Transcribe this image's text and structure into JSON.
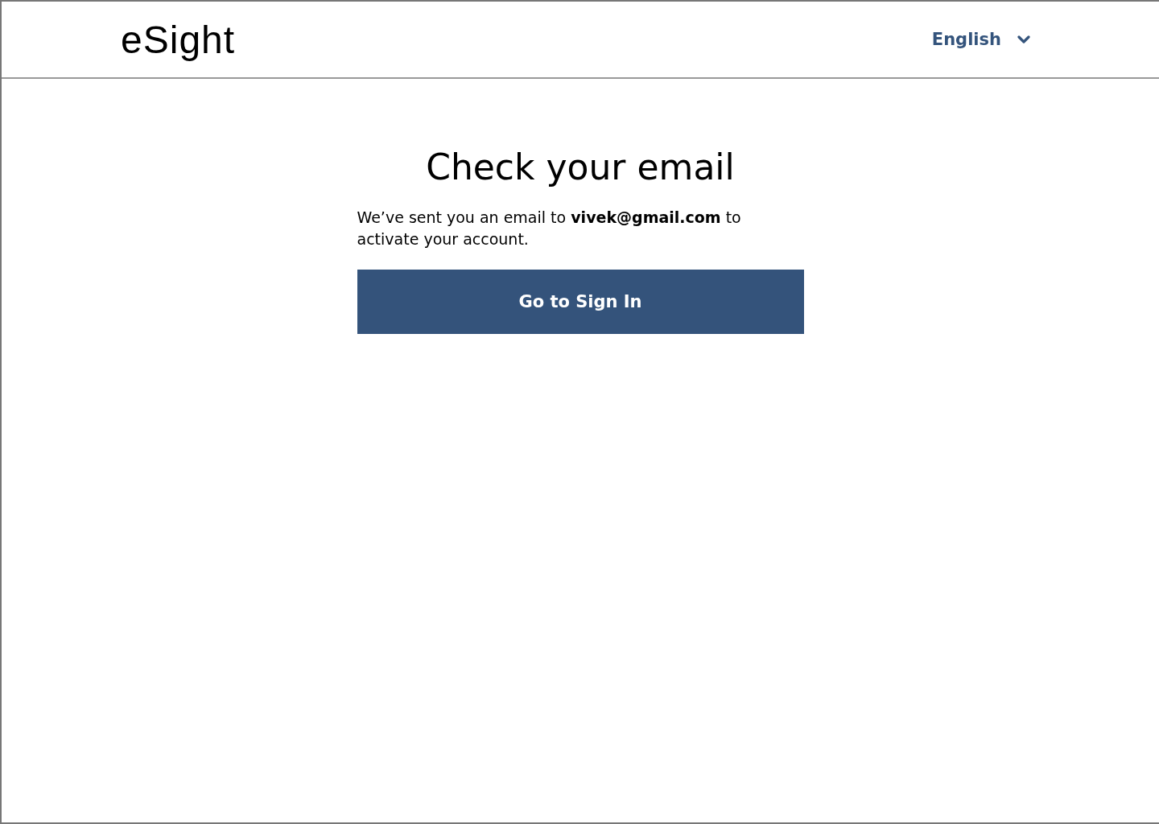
{
  "header": {
    "logo": "eSight",
    "language": "English"
  },
  "title": "Check your email",
  "message": "We’ve sent you an email to **vivek@gmail.com** to activate your account.",
  "button": "Go to Sign In"
}
